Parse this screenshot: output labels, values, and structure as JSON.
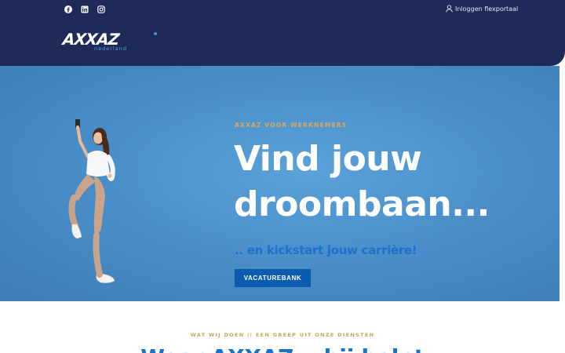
{
  "header": {
    "social": [
      {
        "icon": "facebook-icon"
      },
      {
        "icon": "linkedin-icon"
      },
      {
        "icon": "instagram-icon"
      }
    ],
    "login_label": "Inloggen flexportaal",
    "logo": {
      "word": "AXXAZ",
      "sub": "nederland"
    }
  },
  "hero": {
    "eyebrow": "AXXAZ VOOR WERKNEMERS",
    "headline_line1": "Vind jouw",
    "headline_line2": "droombaan...",
    "subline": ".. en kickstart jouw carrière!",
    "cta_label": "VACATUREBANK"
  },
  "section": {
    "eyebrow": "WAT WIJ DOEN || EEN GREEP UIT ONZE DIENSTEN",
    "title": "Waar AXXAZ u bij helpt"
  },
  "colors": {
    "header_bg": "#1e2a57",
    "hero_bg": "#4a8fca",
    "accent_gold": "#d9a85c",
    "accent_blue": "#1a73c9",
    "cta_bg": "#0b5cae"
  }
}
